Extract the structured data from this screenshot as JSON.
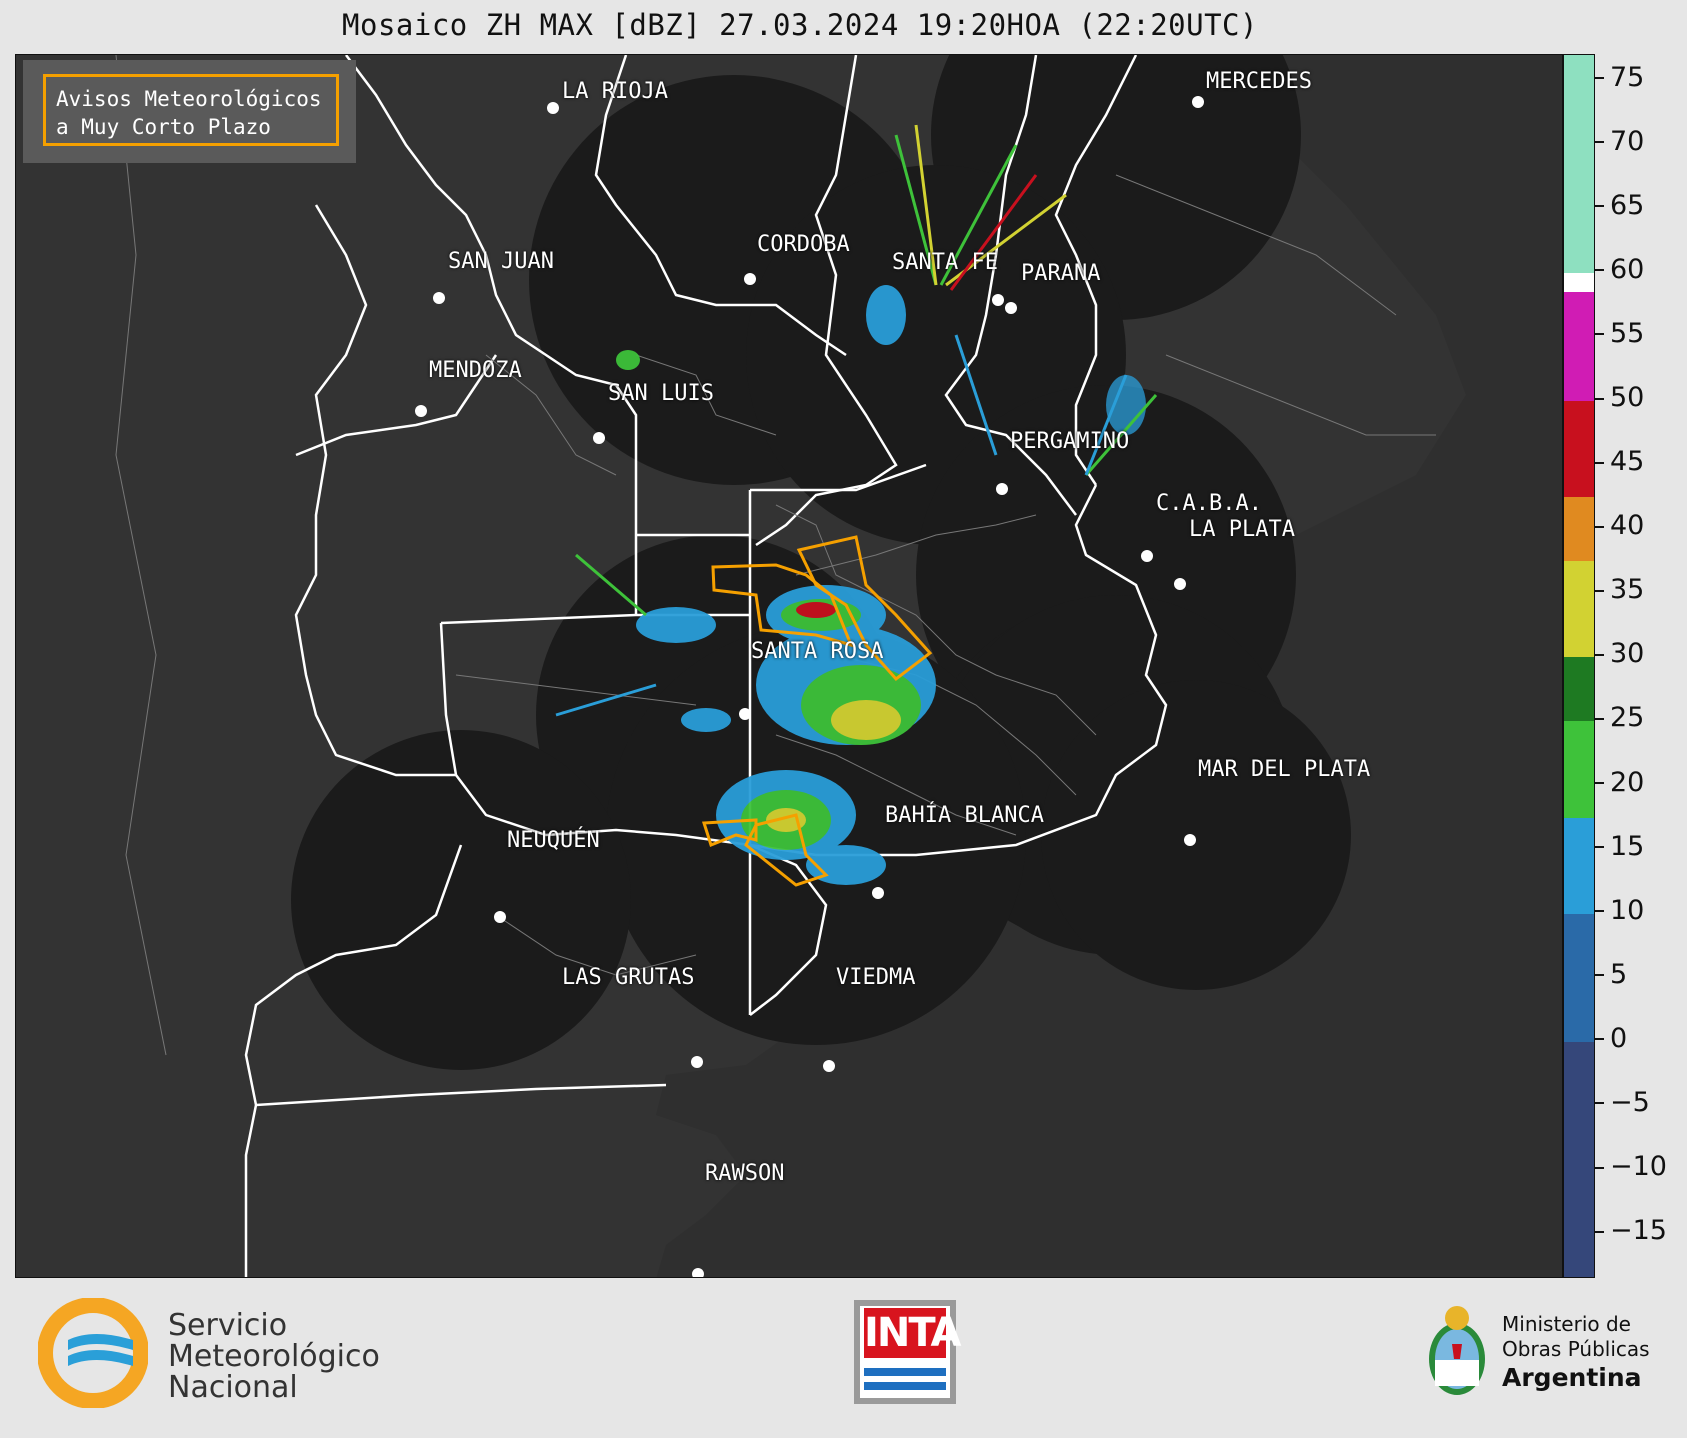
{
  "title": "Mosaico ZH MAX [dBZ] 27.03.2024 19:20HOA (22:20UTC)",
  "legend": {
    "line1": "Avisos Meteorológicos",
    "line2": "a Muy Corto Plazo",
    "accent": "#f5a000"
  },
  "cities": {
    "la_rioja": "LA RIOJA",
    "mercedes": "MERCEDES",
    "cordoba": "CORDOBA",
    "san_juan": "SAN JUAN",
    "santa_fe": "SANTA FE",
    "parana": "PARANA",
    "mendoza": "MENDOZA",
    "san_luis": "SAN LUIS",
    "pergamino": "PERGAMINO",
    "caba": "C.A.B.A.",
    "la_plata": "LA PLATA",
    "santa_rosa": "SANTA ROSA",
    "mar_del_plata": "MAR DEL PLATA",
    "bahia_blanca": "BAHÍA BLANCA",
    "neuquen": "NEUQUÉN",
    "las_grutas": "LAS GRUTAS",
    "viedma": "VIEDMA",
    "rawson": "RAWSON"
  },
  "colorbar": {
    "unit": "dBZ",
    "ticks": [
      "75",
      "70",
      "65",
      "60",
      "55",
      "50",
      "45",
      "40",
      "35",
      "30",
      "25",
      "20",
      "15",
      "10",
      "5",
      "0",
      "−5",
      "−10",
      "−15"
    ],
    "range": [
      -18.5,
      77
    ],
    "scale": [
      {
        "from": -18.5,
        "to": 0,
        "color": "#35477a"
      },
      {
        "from": 0,
        "to": 10,
        "color": "#2a6aa8"
      },
      {
        "from": 10,
        "to": 17.5,
        "color": "#2a9ed8"
      },
      {
        "from": 17.5,
        "to": 25,
        "color": "#3ec23a"
      },
      {
        "from": 25,
        "to": 30,
        "color": "#1e7a22"
      },
      {
        "from": 30,
        "to": 37.5,
        "color": "#d2d232"
      },
      {
        "from": 37.5,
        "to": 42.5,
        "color": "#e08a20"
      },
      {
        "from": 42.5,
        "to": 50,
        "color": "#c8101e"
      },
      {
        "from": 50,
        "to": 58.5,
        "color": "#d01cb4"
      },
      {
        "from": 58.5,
        "to": 60,
        "color": "#ffffff"
      },
      {
        "from": 60,
        "to": 77,
        "color": "#8ee0c0"
      }
    ]
  },
  "footer": {
    "smn_line1": "Servicio",
    "smn_line2": "Meteorológico",
    "smn_line3": "Nacional",
    "inta": "INTA",
    "mop_line1": "Ministerio de",
    "mop_line2": "Obras Públicas",
    "mop_line3": "Argentina",
    "smn_orange": "#f5a623",
    "smn_blue": "#2a9fd8",
    "inta_red": "#d8141e",
    "inta_blue": "#1e6fc0"
  }
}
